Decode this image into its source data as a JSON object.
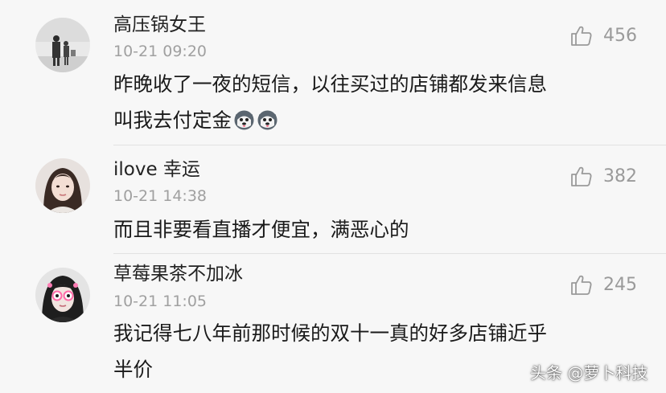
{
  "comments": [
    {
      "username": "高压锅女王",
      "time": "10-21 09:20",
      "likes": "456",
      "lines": [
        "昨晚收了一夜的短信，以往买过的店铺都发来信息",
        "叫我去付定金"
      ],
      "emojis": [
        "husky-emoji",
        "husky-emoji"
      ]
    },
    {
      "username": "ilove 幸运",
      "time": "10-21 14:38",
      "likes": "382",
      "lines": [
        "而且非要看直播才便宜，满恶心的"
      ]
    },
    {
      "username": "草莓果茶不加冰",
      "time": "10-21 11:05",
      "likes": "245",
      "lines": [
        "我记得七八年前那时候的双十一真的好多店铺近乎",
        "半价"
      ]
    }
  ],
  "watermark": "头条 @萝卜科技",
  "colors": {
    "background": "#f7f7f7",
    "username": "#222222",
    "meta": "#a0a0a0",
    "body_text": "#1a1a1a"
  }
}
